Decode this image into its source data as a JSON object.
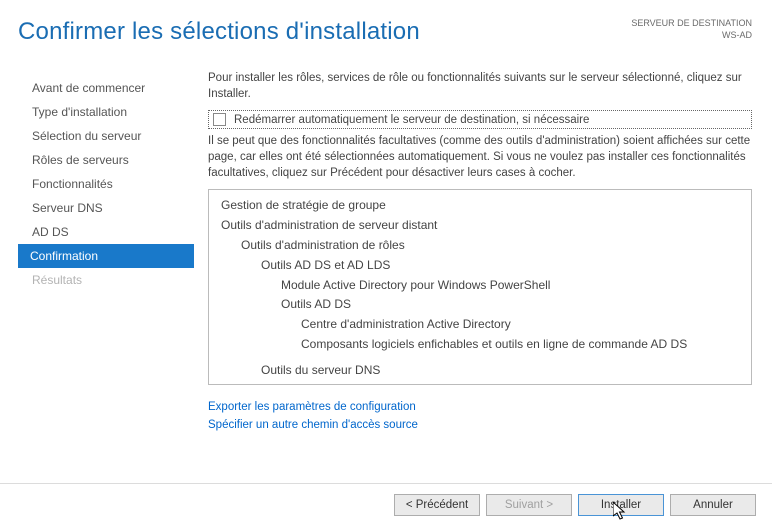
{
  "header": {
    "title": "Confirmer les sélections d'installation",
    "dest_label": "SERVEUR DE DESTINATION",
    "dest_name": "WS-AD"
  },
  "sidebar": {
    "items": [
      {
        "label": "Avant de commencer",
        "state": "normal"
      },
      {
        "label": "Type d'installation",
        "state": "normal"
      },
      {
        "label": "Sélection du serveur",
        "state": "normal"
      },
      {
        "label": "Rôles de serveurs",
        "state": "normal"
      },
      {
        "label": "Fonctionnalités",
        "state": "normal"
      },
      {
        "label": "Serveur DNS",
        "state": "normal"
      },
      {
        "label": "AD DS",
        "state": "normal"
      },
      {
        "label": "Confirmation",
        "state": "active"
      },
      {
        "label": "Résultats",
        "state": "disabled"
      }
    ]
  },
  "content": {
    "intro": "Pour installer les rôles, services de rôle ou fonctionnalités suivants sur le serveur sélectionné, cliquez sur Installer.",
    "checkbox_label": "Redémarrer automatiquement le serveur de destination, si nécessaire",
    "note": "Il se peut que des fonctionnalités facultatives (comme des outils d'administration) soient affichées sur cette page, car elles ont été sélectionnées automatiquement. Si vous ne voulez pas installer ces fonctionnalités facultatives, cliquez sur Précédent pour désactiver leurs cases à cocher.",
    "tree": [
      {
        "level": 0,
        "text": "Gestion de stratégie de groupe"
      },
      {
        "level": 0,
        "text": "Outils d'administration de serveur distant"
      },
      {
        "level": 1,
        "text": "Outils d'administration de rôles"
      },
      {
        "level": 2,
        "text": "Outils AD DS et AD LDS"
      },
      {
        "level": 3,
        "text": "Module Active Directory pour Windows PowerShell"
      },
      {
        "level": 3,
        "text": "Outils AD DS"
      },
      {
        "level": 4,
        "text": "Centre d'administration Active Directory"
      },
      {
        "level": 4,
        "text": "Composants logiciels enfichables et outils en ligne de commande AD DS"
      },
      {
        "level": 2,
        "text": "Outils du serveur DNS"
      }
    ],
    "links": {
      "export": "Exporter les paramètres de configuration",
      "altpath": "Spécifier un autre chemin d'accès source"
    }
  },
  "footer": {
    "prev": "< Précédent",
    "next": "Suivant >",
    "install": "Installer",
    "cancel": "Annuler"
  }
}
